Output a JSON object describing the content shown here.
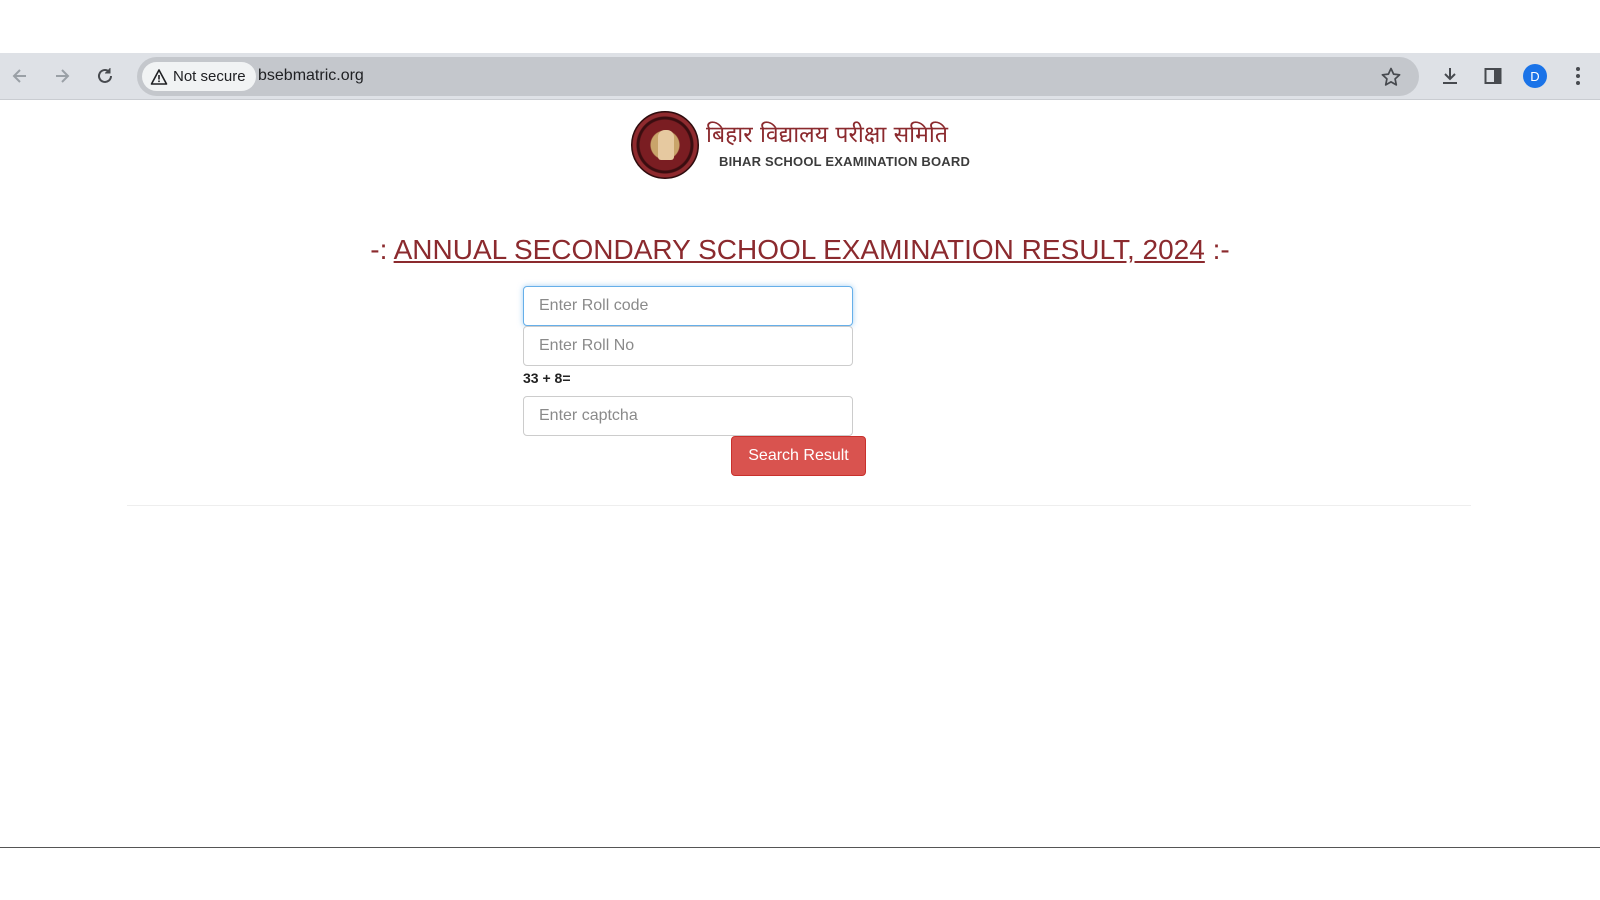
{
  "browser": {
    "security_label": "Not secure",
    "url": "bsebmatric.org",
    "profile_initial": "D"
  },
  "header": {
    "logo_hindi": "बिहार विद्यालय परीक्षा समिति",
    "logo_english": "BIHAR SCHOOL EXAMINATION BOARD"
  },
  "page": {
    "heading_prefix": "-:",
    "heading_main": "ANNUAL SECONDARY SCHOOL EXAMINATION RESULT, 2024",
    "heading_suffix": ":-"
  },
  "form": {
    "roll_code_placeholder": "Enter Roll code",
    "roll_no_placeholder": "Enter Roll No",
    "captcha_question": "33 + 8=",
    "captcha_placeholder": "Enter captcha",
    "submit_label": "Search Result"
  },
  "colors": {
    "accent": "#8b2a2e",
    "button": "#d9534f"
  }
}
